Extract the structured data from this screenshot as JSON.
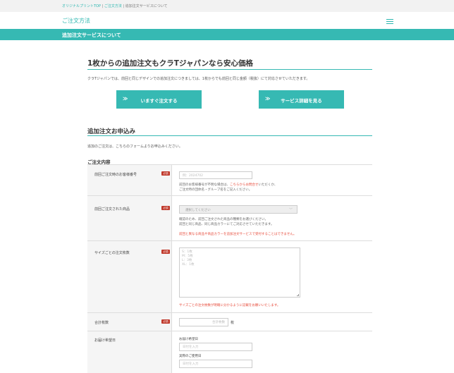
{
  "breadcrumb": {
    "home": "オリジナルプリントTOP",
    "sep1": " | ",
    "order": "ご注文方法",
    "sep2": " | ",
    "current": "追加注文サービスについて"
  },
  "header": {
    "title": "ご注文方法"
  },
  "section_bar": {
    "title": "追加注文サービスについて"
  },
  "hero": {
    "title": "1枚からの追加注文もクラTジャパンなら安心価格",
    "text": "クラTジャパンでは、前回と同じデザインでの追加注文につきましては、1枚からでも前回と同じ金額（税抜）にて対応させていただきます。"
  },
  "cta": {
    "order_label": "いますぐ注文する",
    "detail_label": "サービス詳細を見る",
    "chevron": "≫"
  },
  "form": {
    "heading": "追加注文お申込み",
    "intro": "追加のご注文は、こちらのフォームよりお申込みください。",
    "section_title": "ご注文内容",
    "required_badge": "必須",
    "fields": {
      "order_number": {
        "label": "前回ご注文時のお客様番号",
        "placeholder": "例：2024702",
        "help1_pre": "前回のお客様番号が不明な場合は、",
        "help1_link": "こちらからお問合せ",
        "help1_post": "いただくか、",
        "help2": "ご注文時の団体名・グループ名をご記入ください。"
      },
      "product": {
        "label": "前回ご注文された商品",
        "selected": "選択してください",
        "help1": "確認のため、前回ご注文された商品の種類をお選びください。",
        "help2": "前回と同じ商品、同じ商品カラーにてご対応させていただきます。",
        "warning": "前回と異なる商品や商品カラーを追加注文サービスで受付することはできません。"
      },
      "size_qty": {
        "label": "サイズごとの注文枚数",
        "placeholder_lines": [
          "S：1枚",
          "M：5枚",
          "L：3枚",
          "XL：1枚"
        ],
        "warning": "サイズごとの注文枚数が明確に分かるように記載をお願いいたします。"
      },
      "total": {
        "label": "合計枚数",
        "placeholder": "合計枚数",
        "unit": "枚"
      },
      "delivery": {
        "label": "お届け希望日",
        "sub1": "お届け希望日",
        "placeholder1": "日付を入力",
        "sub2": "実際のご使用日",
        "placeholder2": "日付を入力"
      }
    }
  }
}
